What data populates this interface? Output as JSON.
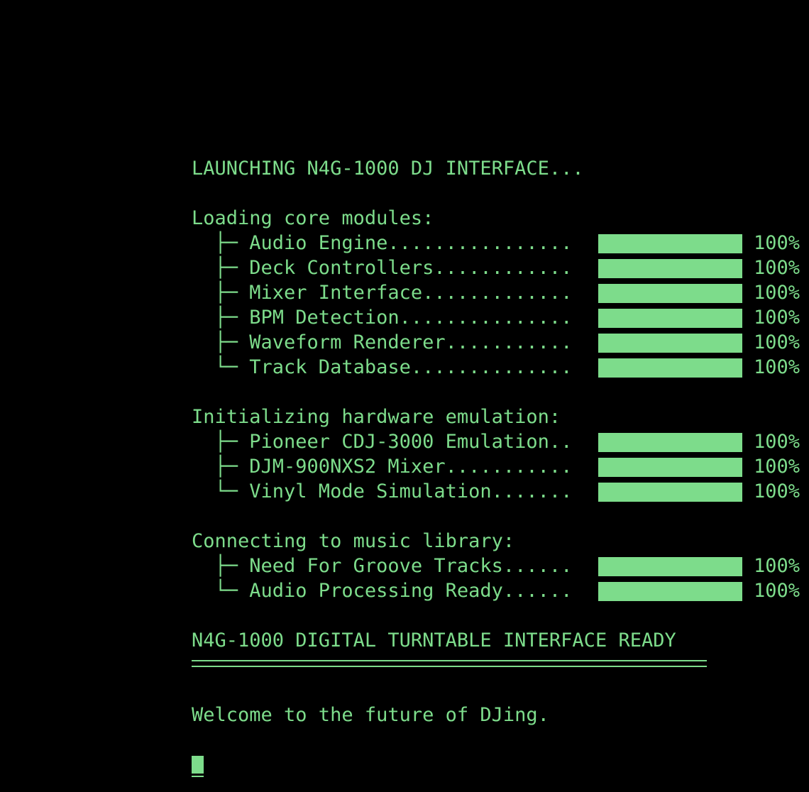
{
  "colors": {
    "background": "#000000",
    "foreground": "#7ddc8b"
  },
  "launch_line": "LAUNCHING N4G-1000 DJ INTERFACE...",
  "sections": [
    {
      "heading": "Loading core modules:",
      "items": [
        {
          "label": "  ├─ Audio Engine................",
          "progress_percent": 100,
          "percent_text": "100%"
        },
        {
          "label": "  ├─ Deck Controllers............",
          "progress_percent": 100,
          "percent_text": "100%"
        },
        {
          "label": "  ├─ Mixer Interface.............",
          "progress_percent": 100,
          "percent_text": "100%"
        },
        {
          "label": "  ├─ BPM Detection...............",
          "progress_percent": 100,
          "percent_text": "100%"
        },
        {
          "label": "  ├─ Waveform Renderer...........",
          "progress_percent": 100,
          "percent_text": "100%"
        },
        {
          "label": "  └─ Track Database..............",
          "progress_percent": 100,
          "percent_text": "100%"
        }
      ]
    },
    {
      "heading": "Initializing hardware emulation:",
      "items": [
        {
          "label": "  ├─ Pioneer CDJ-3000 Emulation..",
          "progress_percent": 100,
          "percent_text": "100%"
        },
        {
          "label": "  ├─ DJM-900NXS2 Mixer...........",
          "progress_percent": 100,
          "percent_text": "100%"
        },
        {
          "label": "  └─ Vinyl Mode Simulation.......",
          "progress_percent": 100,
          "percent_text": "100%"
        }
      ]
    },
    {
      "heading": "Connecting to music library:",
      "items": [
        {
          "label": "  ├─ Need For Groove Tracks......",
          "progress_percent": 100,
          "percent_text": "100%"
        },
        {
          "label": "  └─ Audio Processing Ready......",
          "progress_percent": 100,
          "percent_text": "100%"
        }
      ]
    }
  ],
  "ready_line": "N4G-1000 DIGITAL TURNTABLE INTERFACE READY",
  "welcome_line": "Welcome to the future of DJing."
}
